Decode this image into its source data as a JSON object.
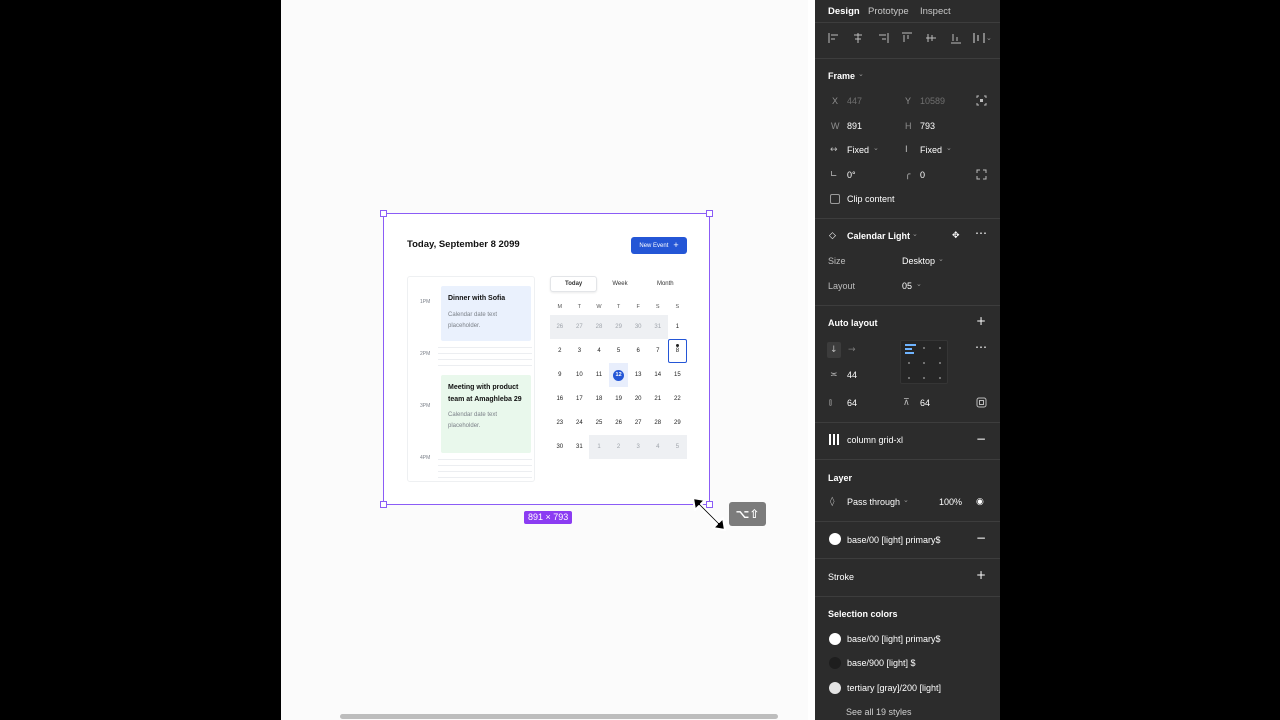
{
  "canvas": {
    "calendar": {
      "title": "Today, September 8 2099",
      "new_event_label": "New Event",
      "times": [
        "1PM",
        "2PM",
        "3PM",
        "4PM"
      ],
      "events": [
        {
          "title": "Dinner with Sofia",
          "description": "Calendar date text placeholder.",
          "color": "#eaf1fd"
        },
        {
          "title": "Meeting with product team at Amaghleba 29",
          "description": "Calendar date text placeholder.",
          "color": "#e9f8ec"
        }
      ],
      "tabs": [
        "Today",
        "Week",
        "Month"
      ],
      "active_tab": "Today",
      "weekdays": [
        "M",
        "T",
        "W",
        "T",
        "F",
        "S",
        "S"
      ],
      "dates": [
        {
          "d": "26",
          "muted": true
        },
        {
          "d": "27",
          "muted": true
        },
        {
          "d": "28",
          "muted": true
        },
        {
          "d": "29",
          "muted": true
        },
        {
          "d": "30",
          "muted": true
        },
        {
          "d": "31",
          "muted": true
        },
        {
          "d": "1"
        },
        {
          "d": "2"
        },
        {
          "d": "3"
        },
        {
          "d": "4"
        },
        {
          "d": "5"
        },
        {
          "d": "6"
        },
        {
          "d": "7"
        },
        {
          "d": "8",
          "outlined": true,
          "dot": true
        },
        {
          "d": "9"
        },
        {
          "d": "10"
        },
        {
          "d": "11"
        },
        {
          "d": "12",
          "selected": true
        },
        {
          "d": "13"
        },
        {
          "d": "14"
        },
        {
          "d": "15"
        },
        {
          "d": "16"
        },
        {
          "d": "17"
        },
        {
          "d": "18"
        },
        {
          "d": "19"
        },
        {
          "d": "20"
        },
        {
          "d": "21"
        },
        {
          "d": "22"
        },
        {
          "d": "23"
        },
        {
          "d": "24"
        },
        {
          "d": "25"
        },
        {
          "d": "26"
        },
        {
          "d": "27"
        },
        {
          "d": "28"
        },
        {
          "d": "29"
        },
        {
          "d": "30"
        },
        {
          "d": "31"
        },
        {
          "d": "1",
          "muted": true
        },
        {
          "d": "2",
          "muted": true
        },
        {
          "d": "3",
          "muted": true
        },
        {
          "d": "4",
          "muted": true
        },
        {
          "d": "5",
          "muted": true
        }
      ],
      "accent": "#2456d6"
    },
    "size_badge": "891 × 793",
    "modifier_keys": "⌥⇧",
    "selection_color": "#8b5cf6"
  },
  "panel": {
    "tabs": [
      "Design",
      "Prototype",
      "Inspect"
    ],
    "active_tab": "Design",
    "frame": {
      "title": "Frame",
      "x_label": "X",
      "x_value": "447",
      "y_label": "Y",
      "y_value": "10589",
      "w_label": "W",
      "w_value": "891",
      "h_label": "H",
      "h_value": "793",
      "horizontal_sizing": "Fixed",
      "vertical_sizing": "Fixed",
      "rotation": "0°",
      "radius": "0",
      "clip_content_label": "Clip content"
    },
    "component": {
      "name": "Calendar Light",
      "size_label": "Size",
      "size_value": "Desktop",
      "layout_label": "Layout",
      "layout_value": "05"
    },
    "auto_layout": {
      "title": "Auto layout",
      "gap": "44",
      "padding_horizontal": "64",
      "padding_vertical": "64"
    },
    "layout_grid": "column grid-xl",
    "layer": {
      "title": "Layer",
      "blend": "Pass through",
      "opacity": "100%"
    },
    "fill": {
      "name": "base/00 [light] primary$",
      "color": "#ffffff"
    },
    "stroke_title": "Stroke",
    "selection_colors": {
      "title": "Selection colors",
      "items": [
        {
          "name": "base/00 [light] primary$",
          "color": "#ffffff"
        },
        {
          "name": "base/900 [light] $",
          "color": "#1e1e1e"
        },
        {
          "name": "tertiary [gray]/200 [light]",
          "color": "#e4e4e4"
        }
      ],
      "see_all": "See all 19 styles"
    }
  }
}
